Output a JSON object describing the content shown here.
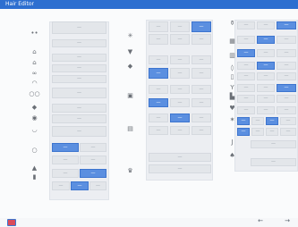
{
  "window": {
    "title": "Hair Editor"
  },
  "icons": {
    "c1": [
      "eyes-icon",
      "hat-icon",
      "hat2-icon",
      "glasses-icon",
      "mask-icon",
      "goggles-icon",
      "earring-icon",
      "necklace-icon",
      "collar-icon",
      "ring-icon",
      "helmet-icon",
      "flag-icon"
    ],
    "c2": [
      "fan-icon",
      "cape-icon",
      "shield-icon",
      "armor-icon",
      "pack-icon",
      "crown-icon"
    ],
    "c3": [
      "vase-icon",
      "shirt-icon",
      "jacket-icon",
      "gem-icon",
      "bottle-icon",
      "bunny-icon",
      "boot-icon",
      "heart-icon",
      "amulet-icon",
      "hook-icon",
      "spade-icon"
    ]
  },
  "footer": {
    "prev": "←",
    "next": "→"
  }
}
